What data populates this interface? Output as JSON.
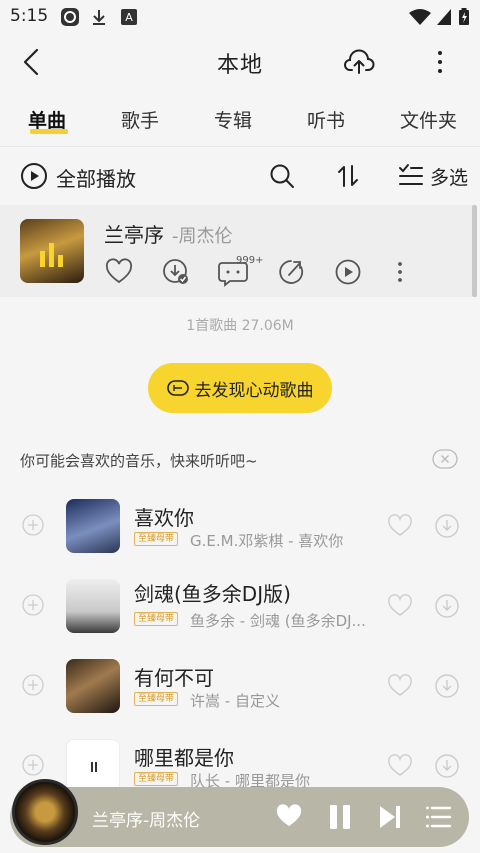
{
  "status": {
    "time": "5:15"
  },
  "header": {
    "title": "本地"
  },
  "tabs": [
    "单曲",
    "歌手",
    "专辑",
    "听书",
    "文件夹"
  ],
  "actions": {
    "play_all": "全部播放",
    "multi_select": "多选"
  },
  "now_playing": {
    "title": "兰亭序",
    "artist": "-周杰伦",
    "comment_count": "999+"
  },
  "summary": "1首歌曲 27.06M",
  "discover_button": "去发现心动歌曲",
  "recommend": {
    "header": "你可能会喜欢的音乐，快来听听吧~",
    "badge": "至臻母带",
    "items": [
      {
        "title": "喜欢你",
        "subtitle": "G.E.M.邓紫棋 - 喜欢你"
      },
      {
        "title": "剑魂(鱼多余DJ版)",
        "subtitle": "鱼多余 - 剑魂 (鱼多余DJ..."
      },
      {
        "title": "有何不可",
        "subtitle": "许嵩 - 自定义"
      },
      {
        "title": "哪里都是你",
        "subtitle": "队长 - 哪里都是你"
      }
    ]
  },
  "mini_player": {
    "title": "兰亭序-周杰伦"
  }
}
